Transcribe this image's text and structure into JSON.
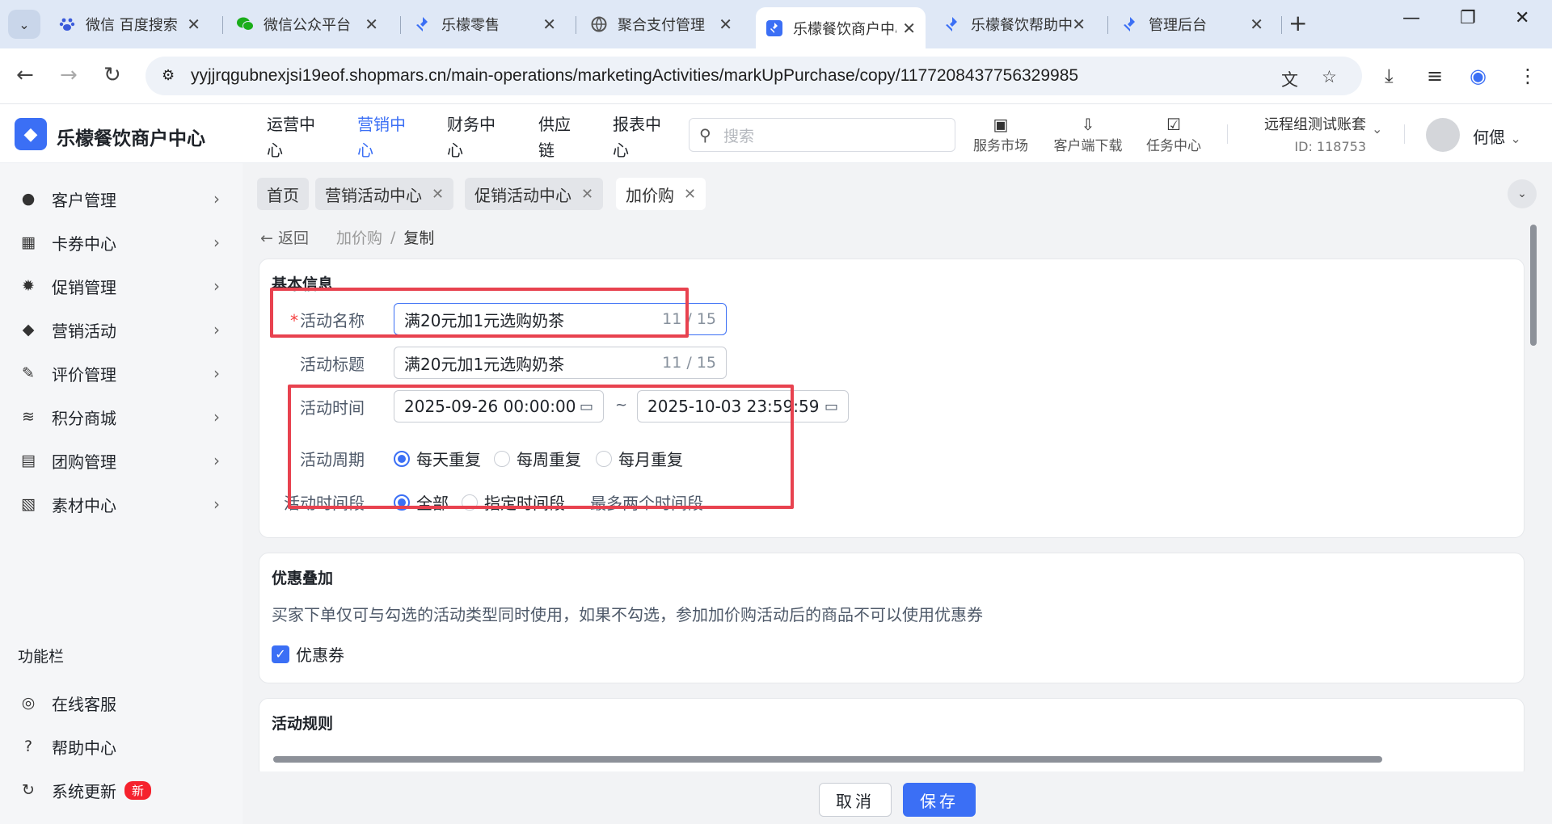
{
  "browser": {
    "tabs": [
      {
        "title": "微信 百度搜索",
        "icon": "baidu-icon"
      },
      {
        "title": "微信公众平台",
        "icon": "wechat-icon"
      },
      {
        "title": "乐檬零售",
        "icon": "lemeng-icon"
      },
      {
        "title": "聚合支付管理",
        "icon": "globe-icon"
      },
      {
        "title": "乐檬餐饮商户中心",
        "icon": "lemeng-icon"
      },
      {
        "title": "乐檬餐饮帮助中心",
        "icon": "lemeng-icon"
      },
      {
        "title": "管理后台",
        "icon": "lemeng-icon"
      }
    ],
    "active_tab_index": 4,
    "url": "yyjjrqgubnexjsi19eof.shopmars.cn/main-operations/marketingActivities/markUpPurchase/copy/1177208437756329985"
  },
  "header": {
    "brand": "乐檬餐饮商户中心",
    "nav": [
      {
        "label": "运营中心"
      },
      {
        "label": "营销中心"
      },
      {
        "label": "财务中心"
      },
      {
        "label": "供应链"
      },
      {
        "label": "报表中心"
      }
    ],
    "active_nav_index": 1,
    "search_placeholder": "搜索",
    "tools": [
      {
        "label": "服务市场",
        "icon": "briefcase-icon"
      },
      {
        "label": "客户端下载",
        "icon": "download-folder-icon"
      },
      {
        "label": "任务中心",
        "icon": "clipboard-check-icon"
      }
    ],
    "account_name": "远程组测试账套",
    "account_id": "ID: 118753",
    "user_name": "何偲"
  },
  "sidebar": {
    "items": [
      {
        "label": "客户管理",
        "icon": "user-icon"
      },
      {
        "label": "卡券中心",
        "icon": "ticket-icon"
      },
      {
        "label": "促销管理",
        "icon": "gear-badge-icon"
      },
      {
        "label": "营销活动",
        "icon": "tag-icon"
      },
      {
        "label": "评价管理",
        "icon": "edit-icon"
      },
      {
        "label": "积分商城",
        "icon": "database-icon"
      },
      {
        "label": "团购管理",
        "icon": "gift-icon"
      },
      {
        "label": "素材中心",
        "icon": "image-icon"
      }
    ],
    "section_title": "功能栏",
    "function_items": [
      {
        "label": "在线客服",
        "icon": "headset-icon"
      },
      {
        "label": "帮助中心",
        "icon": "help-icon"
      },
      {
        "label": "系统更新",
        "icon": "refresh-icon",
        "badge": "新"
      }
    ]
  },
  "page_tabs": [
    {
      "label": "首页",
      "closable": false
    },
    {
      "label": "营销活动中心",
      "closable": true
    },
    {
      "label": "促销活动中心",
      "closable": true
    },
    {
      "label": "加价购",
      "closable": true
    }
  ],
  "breadcrumb": {
    "back": "返回",
    "items": [
      "加价购",
      "复制"
    ],
    "separator": "/"
  },
  "basic_info": {
    "title": "基本信息",
    "activity_name_label": "活动名称",
    "activity_name_value": "满20元加1元选购奶茶",
    "activity_name_count": "11 / 15",
    "activity_title_label": "活动标题",
    "activity_title_value": "满20元加1元选购奶茶",
    "activity_title_count": "11 / 15",
    "time_label": "活动时间",
    "start_time": "2025-09-26 00:00:00",
    "end_time": "2025-10-03 23:59:59",
    "range_sep": "~",
    "cycle_label": "活动周期",
    "cycle_options": [
      "每天重复",
      "每周重复",
      "每月重复"
    ],
    "cycle_selected": 0,
    "period_label": "活动时间段",
    "period_options": [
      "全部",
      "指定时间段"
    ],
    "period_selected": 0,
    "period_hint": "最多两个时间段"
  },
  "stacking": {
    "title": "优惠叠加",
    "desc": "买家下单仅可与勾选的活动类型同时使用，如果不勾选，参加加价购活动后的商品不可以使用优惠券",
    "coupon_label": "优惠券",
    "coupon_checked": true
  },
  "rules": {
    "title": "活动规则"
  },
  "footer": {
    "cancel": "取消",
    "save": "保存"
  },
  "colors": {
    "accent": "#3b6ff5",
    "highlight_box": "#e8424f",
    "badge": "#f5222d"
  }
}
